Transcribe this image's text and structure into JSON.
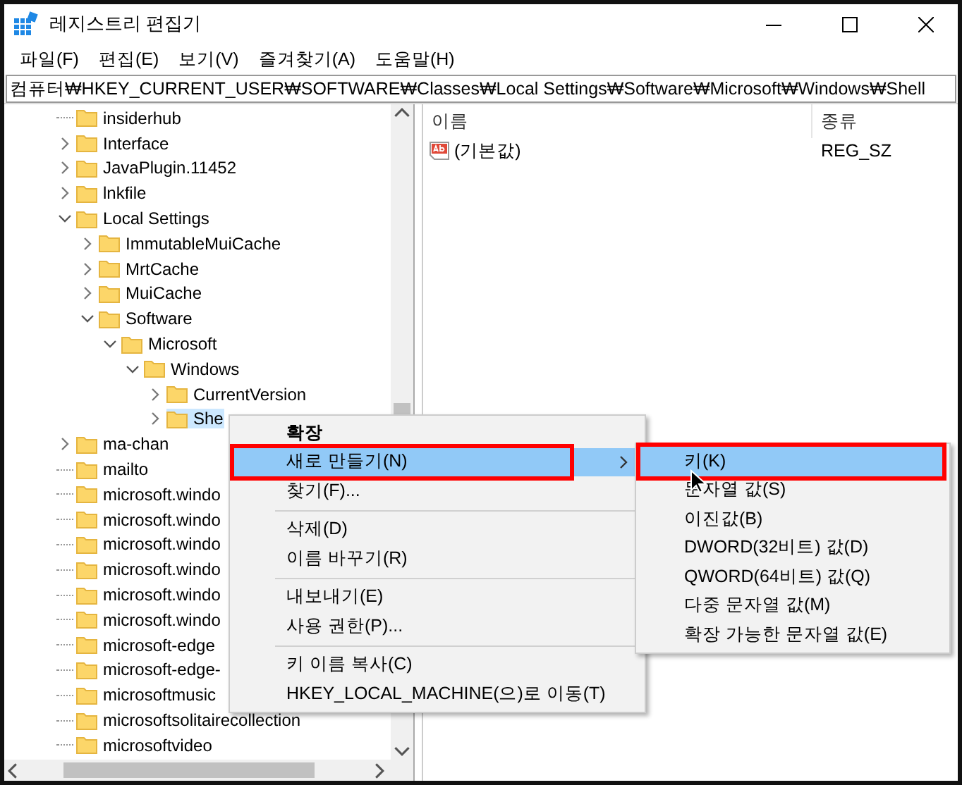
{
  "window": {
    "title": "레지스트리 편집기"
  },
  "menu_bar": [
    "파일(F)",
    "편집(E)",
    "보기(V)",
    "즐겨찾기(A)",
    "도움말(H)"
  ],
  "address_bar": {
    "value": "컴퓨터₩HKEY_CURRENT_USER₩SOFTWARE₩Classes₩Local Settings₩Software₩Microsoft₩Windows₩Shell"
  },
  "tree": [
    {
      "label": "insiderhub",
      "kind": "leaf",
      "selected": false
    },
    {
      "label": "Interface",
      "kind": "node",
      "expanded": false,
      "selected": false
    },
    {
      "label": "JavaPlugin.11452",
      "kind": "node",
      "expanded": false,
      "selected": false
    },
    {
      "label": "lnkfile",
      "kind": "node",
      "expanded": false,
      "selected": false
    },
    {
      "label": "Local Settings",
      "kind": "node",
      "expanded": true,
      "selected": false,
      "children": [
        {
          "label": "ImmutableMuiCache",
          "kind": "node",
          "expanded": false,
          "selected": false
        },
        {
          "label": "MrtCache",
          "kind": "node",
          "expanded": false,
          "selected": false
        },
        {
          "label": "MuiCache",
          "kind": "node",
          "expanded": false,
          "selected": false
        },
        {
          "label": "Software",
          "kind": "node",
          "expanded": true,
          "selected": false,
          "children": [
            {
              "label": "Microsoft",
              "kind": "node",
              "expanded": true,
              "selected": false,
              "children": [
                {
                  "label": "Windows",
                  "kind": "node",
                  "expanded": true,
                  "selected": false,
                  "children": [
                    {
                      "label": "CurrentVersion",
                      "kind": "node",
                      "expanded": false,
                      "selected": false
                    },
                    {
                      "label": "She",
                      "kind": "node",
                      "expanded": false,
                      "selected": true
                    }
                  ]
                }
              ]
            }
          ]
        }
      ]
    },
    {
      "label": "ma-chan",
      "kind": "node",
      "expanded": false,
      "selected": false
    },
    {
      "label": "mailto",
      "kind": "leaf",
      "selected": false
    },
    {
      "label": "microsoft.windo",
      "kind": "leaf",
      "selected": false
    },
    {
      "label": "microsoft.windo",
      "kind": "leaf",
      "selected": false
    },
    {
      "label": "microsoft.windo",
      "kind": "leaf",
      "selected": false
    },
    {
      "label": "microsoft.windo",
      "kind": "leaf",
      "selected": false
    },
    {
      "label": "microsoft.windo",
      "kind": "leaf",
      "selected": false
    },
    {
      "label": "microsoft.windo",
      "kind": "leaf",
      "selected": false
    },
    {
      "label": "microsoft-edge",
      "kind": "leaf",
      "selected": false
    },
    {
      "label": "microsoft-edge-",
      "kind": "leaf",
      "selected": false
    },
    {
      "label": "microsoftmusic",
      "kind": "leaf",
      "selected": false
    },
    {
      "label": "microsoftsolitairecollection",
      "kind": "leaf",
      "selected": false
    },
    {
      "label": "microsoftvideo",
      "kind": "leaf",
      "selected": false
    }
  ],
  "values_table": {
    "columns": [
      "이름",
      "종류"
    ],
    "rows": [
      {
        "name": "(기본값)",
        "type": "REG_SZ"
      }
    ]
  },
  "context_menu": {
    "items": [
      {
        "kind": "item",
        "label": "확장",
        "bold": true,
        "selected": false,
        "submenu": false,
        "outlined": false
      },
      {
        "kind": "item",
        "label": "새로 만들기(N)",
        "bold": false,
        "selected": true,
        "submenu": true,
        "outlined": true
      },
      {
        "kind": "item",
        "label": "찾기(F)...",
        "bold": false,
        "selected": false,
        "submenu": false,
        "outlined": false
      },
      {
        "kind": "separator"
      },
      {
        "kind": "item",
        "label": "삭제(D)",
        "bold": false,
        "selected": false,
        "submenu": false,
        "outlined": false
      },
      {
        "kind": "item",
        "label": "이름 바꾸기(R)",
        "bold": false,
        "selected": false,
        "submenu": false,
        "outlined": false
      },
      {
        "kind": "separator"
      },
      {
        "kind": "item",
        "label": "내보내기(E)",
        "bold": false,
        "selected": false,
        "submenu": false,
        "outlined": false
      },
      {
        "kind": "item",
        "label": "사용 권한(P)...",
        "bold": false,
        "selected": false,
        "submenu": false,
        "outlined": false
      },
      {
        "kind": "separator"
      },
      {
        "kind": "item",
        "label": "키 이름 복사(C)",
        "bold": false,
        "selected": false,
        "submenu": false,
        "outlined": false
      },
      {
        "kind": "item",
        "label": "HKEY_LOCAL_MACHINE(으)로 이동(T)",
        "bold": false,
        "selected": false,
        "submenu": false,
        "outlined": false
      }
    ]
  },
  "submenu": {
    "items": [
      {
        "kind": "item",
        "label": "키(K)",
        "selected": true,
        "outlined": true
      },
      {
        "kind": "item",
        "label": "문자열 값(S)",
        "selected": false,
        "outlined": false
      },
      {
        "kind": "item",
        "label": "이진값(B)",
        "selected": false,
        "outlined": false
      },
      {
        "kind": "item",
        "label": "DWORD(32비트) 값(D)",
        "selected": false,
        "outlined": false
      },
      {
        "kind": "item",
        "label": "QWORD(64비트) 값(Q)",
        "selected": false,
        "outlined": false
      },
      {
        "kind": "item",
        "label": "다중 문자열 값(M)",
        "selected": false,
        "outlined": false
      },
      {
        "kind": "item",
        "label": "확장 가능한 문자열 값(E)",
        "selected": false,
        "outlined": false
      }
    ]
  }
}
